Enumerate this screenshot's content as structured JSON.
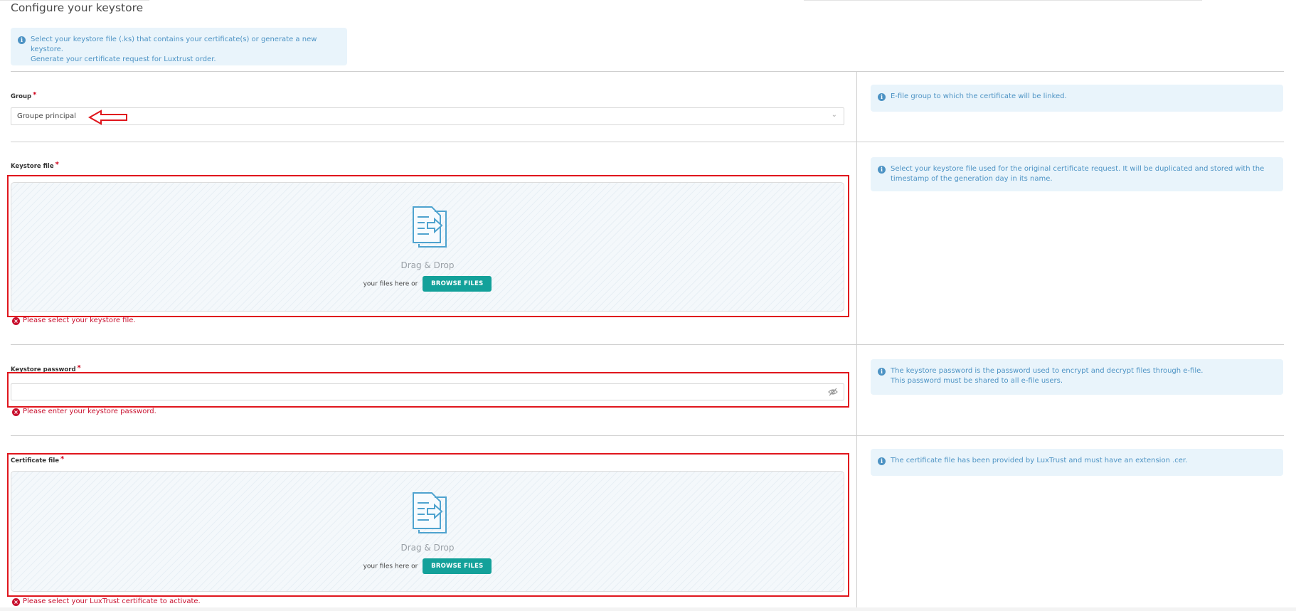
{
  "page": {
    "title": "Configure your keystore"
  },
  "intro": {
    "line1": "Select your keystore file (.ks) that contains your certificate(s) or generate a new keystore.",
    "line2": "Generate your certificate request for Luxtrust order."
  },
  "group": {
    "label": "Group",
    "required_mark": "*",
    "selected_value": "Groupe principal",
    "help": "E-file group to which the certificate will be linked."
  },
  "keystore_file": {
    "label": "Keystore file",
    "required_mark": "*",
    "drag_title": "Drag & Drop",
    "drag_text": "your files here or",
    "browse_label": "BROWSE FILES",
    "error": "Please select your keystore file.",
    "help_line1": "Select your keystore file used for the original certificate request. It will be duplicated and stored with the",
    "help_line2": "timestamp of the generation day in its name."
  },
  "keystore_password": {
    "label": "Keystore password",
    "required_mark": "*",
    "value": "",
    "error": "Please enter your keystore password.",
    "help_line1": "The keystore password is the password used to encrypt and decrypt files through e-file.",
    "help_line2": "This password must be shared to all e-file users."
  },
  "certificate_file": {
    "label": "Certificate file",
    "required_mark": "*",
    "drag_title": "Drag & Drop",
    "drag_text": "your files here or",
    "browse_label": "BROWSE FILES",
    "error": "Please select your LuxTrust certificate to activate.",
    "help": "The certificate file has been provided by LuxTrust and must have an extension .cer."
  },
  "colors": {
    "accent": "#13a19a",
    "error": "#c8102e",
    "info_bg": "#e9f4fb",
    "info_text": "#4d93c4",
    "highlight_box": "#e0161d"
  },
  "icons": {
    "info": "info-icon",
    "dropdown": "chevron-down-icon",
    "file_upload": "file-upload-icon",
    "error": "error-circle-icon",
    "password_toggle": "eye-off-icon",
    "annotation": "left-arrow-annotation"
  }
}
